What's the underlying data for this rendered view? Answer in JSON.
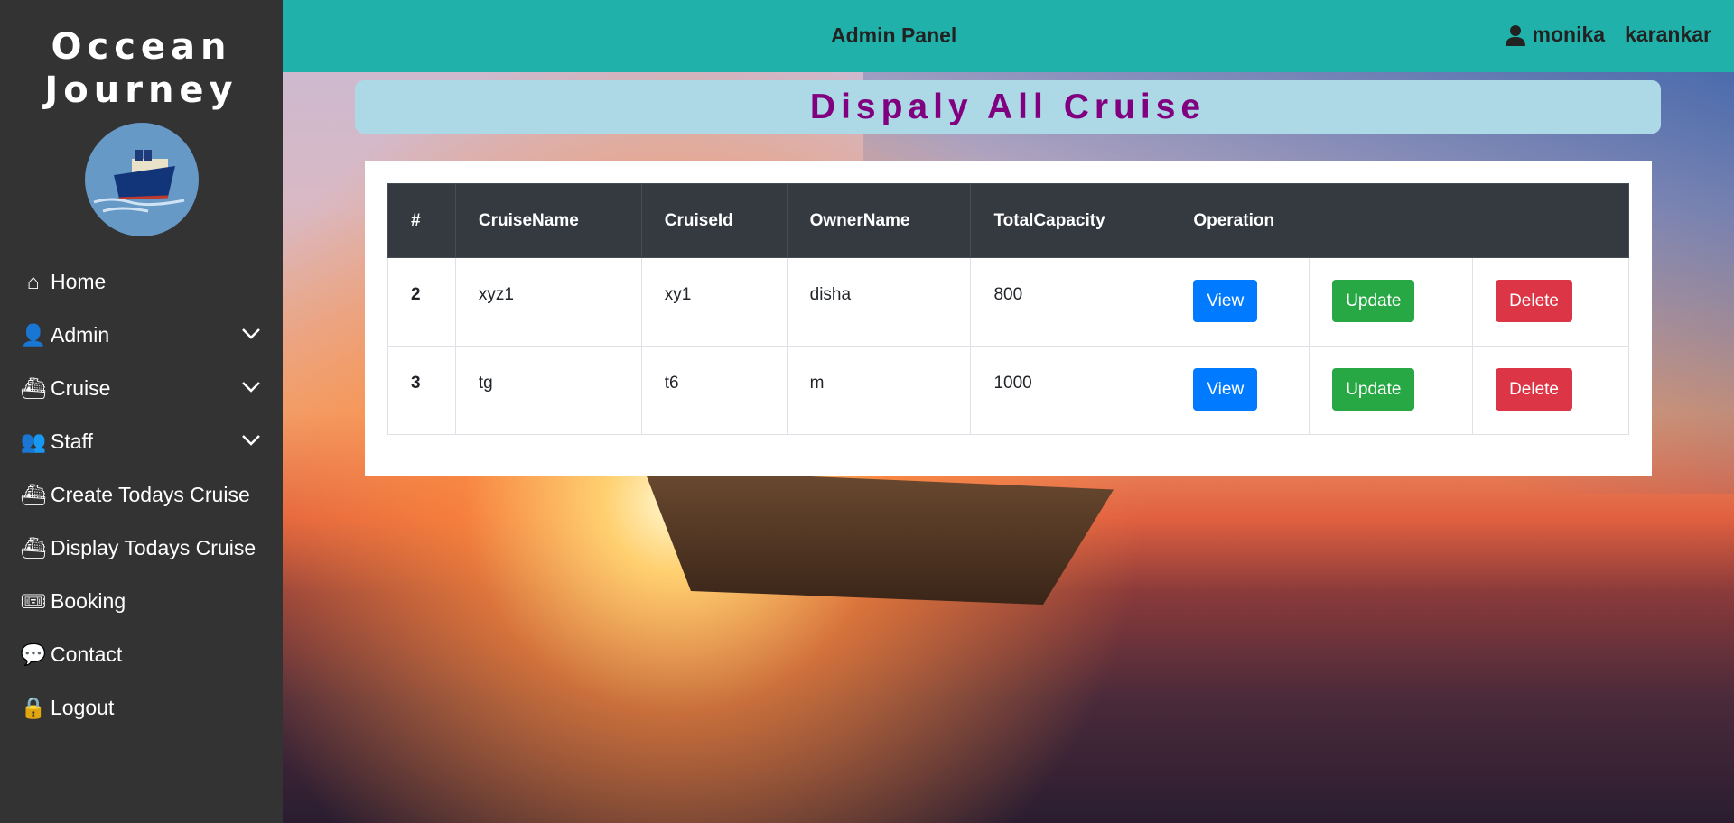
{
  "brand": {
    "line1": "Occean",
    "line2": "Journey"
  },
  "sidebar": {
    "items": [
      {
        "label": "Home",
        "icon": "home-icon"
      },
      {
        "label": "Admin",
        "icon": "user-icon",
        "chevron": true
      },
      {
        "label": "Cruise",
        "icon": "ship-icon",
        "chevron": true
      },
      {
        "label": "Staff",
        "icon": "users-icon",
        "chevron": true
      },
      {
        "label": "Create Todays Cruise",
        "icon": "ship-icon"
      },
      {
        "label": "Display Todays Cruise",
        "icon": "ship-icon"
      },
      {
        "label": "Booking",
        "icon": "ticket-icon"
      },
      {
        "label": "Contact",
        "icon": "comment-icon"
      },
      {
        "label": "Logout",
        "icon": "lock-icon"
      }
    ]
  },
  "topbar": {
    "title": "Admin Panel",
    "first_name": "monika",
    "last_name": "karankar"
  },
  "page_title": "Dispaly All Cruise",
  "table": {
    "headers": [
      "#",
      "CruiseName",
      "CruiseId",
      "OwnerName",
      "TotalCapacity",
      "Operation"
    ],
    "rows": [
      {
        "num": "2",
        "name": "xyz1",
        "id": "xy1",
        "owner": "disha",
        "capacity": "800"
      },
      {
        "num": "3",
        "name": "tg",
        "id": "t6",
        "owner": "m",
        "capacity": "1000"
      }
    ],
    "view_label": "View",
    "update_label": "Update",
    "delete_label": "Delete"
  },
  "colors": {
    "topbar": "#20b2aa",
    "sidebar": "#333333",
    "title": "#800080",
    "view": "#007bff",
    "update": "#28a745",
    "delete": "#dc3545"
  }
}
